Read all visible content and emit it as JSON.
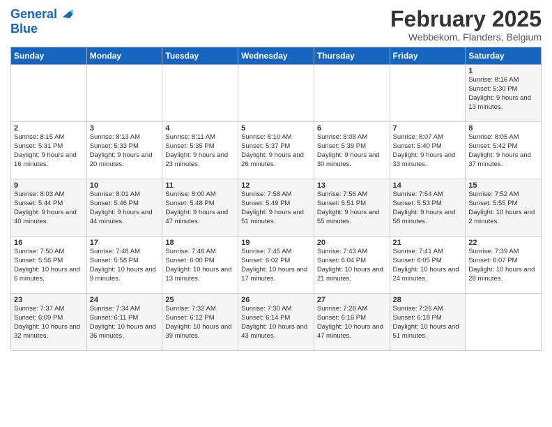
{
  "header": {
    "logo_line1": "General",
    "logo_line2": "Blue",
    "title": "February 2025",
    "subtitle": "Webbekom, Flanders, Belgium"
  },
  "weekdays": [
    "Sunday",
    "Monday",
    "Tuesday",
    "Wednesday",
    "Thursday",
    "Friday",
    "Saturday"
  ],
  "weeks": [
    [
      {
        "day": "",
        "info": ""
      },
      {
        "day": "",
        "info": ""
      },
      {
        "day": "",
        "info": ""
      },
      {
        "day": "",
        "info": ""
      },
      {
        "day": "",
        "info": ""
      },
      {
        "day": "",
        "info": ""
      },
      {
        "day": "1",
        "info": "Sunrise: 8:16 AM\nSunset: 5:30 PM\nDaylight: 9 hours and 13 minutes."
      }
    ],
    [
      {
        "day": "2",
        "info": "Sunrise: 8:15 AM\nSunset: 5:31 PM\nDaylight: 9 hours and 16 minutes."
      },
      {
        "day": "3",
        "info": "Sunrise: 8:13 AM\nSunset: 5:33 PM\nDaylight: 9 hours and 20 minutes."
      },
      {
        "day": "4",
        "info": "Sunrise: 8:11 AM\nSunset: 5:35 PM\nDaylight: 9 hours and 23 minutes."
      },
      {
        "day": "5",
        "info": "Sunrise: 8:10 AM\nSunset: 5:37 PM\nDaylight: 9 hours and 26 minutes."
      },
      {
        "day": "6",
        "info": "Sunrise: 8:08 AM\nSunset: 5:39 PM\nDaylight: 9 hours and 30 minutes."
      },
      {
        "day": "7",
        "info": "Sunrise: 8:07 AM\nSunset: 5:40 PM\nDaylight: 9 hours and 33 minutes."
      },
      {
        "day": "8",
        "info": "Sunrise: 8:05 AM\nSunset: 5:42 PM\nDaylight: 9 hours and 37 minutes."
      }
    ],
    [
      {
        "day": "9",
        "info": "Sunrise: 8:03 AM\nSunset: 5:44 PM\nDaylight: 9 hours and 40 minutes."
      },
      {
        "day": "10",
        "info": "Sunrise: 8:01 AM\nSunset: 5:46 PM\nDaylight: 9 hours and 44 minutes."
      },
      {
        "day": "11",
        "info": "Sunrise: 8:00 AM\nSunset: 5:48 PM\nDaylight: 9 hours and 47 minutes."
      },
      {
        "day": "12",
        "info": "Sunrise: 7:58 AM\nSunset: 5:49 PM\nDaylight: 9 hours and 51 minutes."
      },
      {
        "day": "13",
        "info": "Sunrise: 7:56 AM\nSunset: 5:51 PM\nDaylight: 9 hours and 55 minutes."
      },
      {
        "day": "14",
        "info": "Sunrise: 7:54 AM\nSunset: 5:53 PM\nDaylight: 9 hours and 58 minutes."
      },
      {
        "day": "15",
        "info": "Sunrise: 7:52 AM\nSunset: 5:55 PM\nDaylight: 10 hours and 2 minutes."
      }
    ],
    [
      {
        "day": "16",
        "info": "Sunrise: 7:50 AM\nSunset: 5:56 PM\nDaylight: 10 hours and 6 minutes."
      },
      {
        "day": "17",
        "info": "Sunrise: 7:48 AM\nSunset: 5:58 PM\nDaylight: 10 hours and 9 minutes."
      },
      {
        "day": "18",
        "info": "Sunrise: 7:46 AM\nSunset: 6:00 PM\nDaylight: 10 hours and 13 minutes."
      },
      {
        "day": "19",
        "info": "Sunrise: 7:45 AM\nSunset: 6:02 PM\nDaylight: 10 hours and 17 minutes."
      },
      {
        "day": "20",
        "info": "Sunrise: 7:43 AM\nSunset: 6:04 PM\nDaylight: 10 hours and 21 minutes."
      },
      {
        "day": "21",
        "info": "Sunrise: 7:41 AM\nSunset: 6:05 PM\nDaylight: 10 hours and 24 minutes."
      },
      {
        "day": "22",
        "info": "Sunrise: 7:39 AM\nSunset: 6:07 PM\nDaylight: 10 hours and 28 minutes."
      }
    ],
    [
      {
        "day": "23",
        "info": "Sunrise: 7:37 AM\nSunset: 6:09 PM\nDaylight: 10 hours and 32 minutes."
      },
      {
        "day": "24",
        "info": "Sunrise: 7:34 AM\nSunset: 6:11 PM\nDaylight: 10 hours and 36 minutes."
      },
      {
        "day": "25",
        "info": "Sunrise: 7:32 AM\nSunset: 6:12 PM\nDaylight: 10 hours and 39 minutes."
      },
      {
        "day": "26",
        "info": "Sunrise: 7:30 AM\nSunset: 6:14 PM\nDaylight: 10 hours and 43 minutes."
      },
      {
        "day": "27",
        "info": "Sunrise: 7:28 AM\nSunset: 6:16 PM\nDaylight: 10 hours and 47 minutes."
      },
      {
        "day": "28",
        "info": "Sunrise: 7:26 AM\nSunset: 6:18 PM\nDaylight: 10 hours and 51 minutes."
      },
      {
        "day": "",
        "info": ""
      }
    ]
  ]
}
